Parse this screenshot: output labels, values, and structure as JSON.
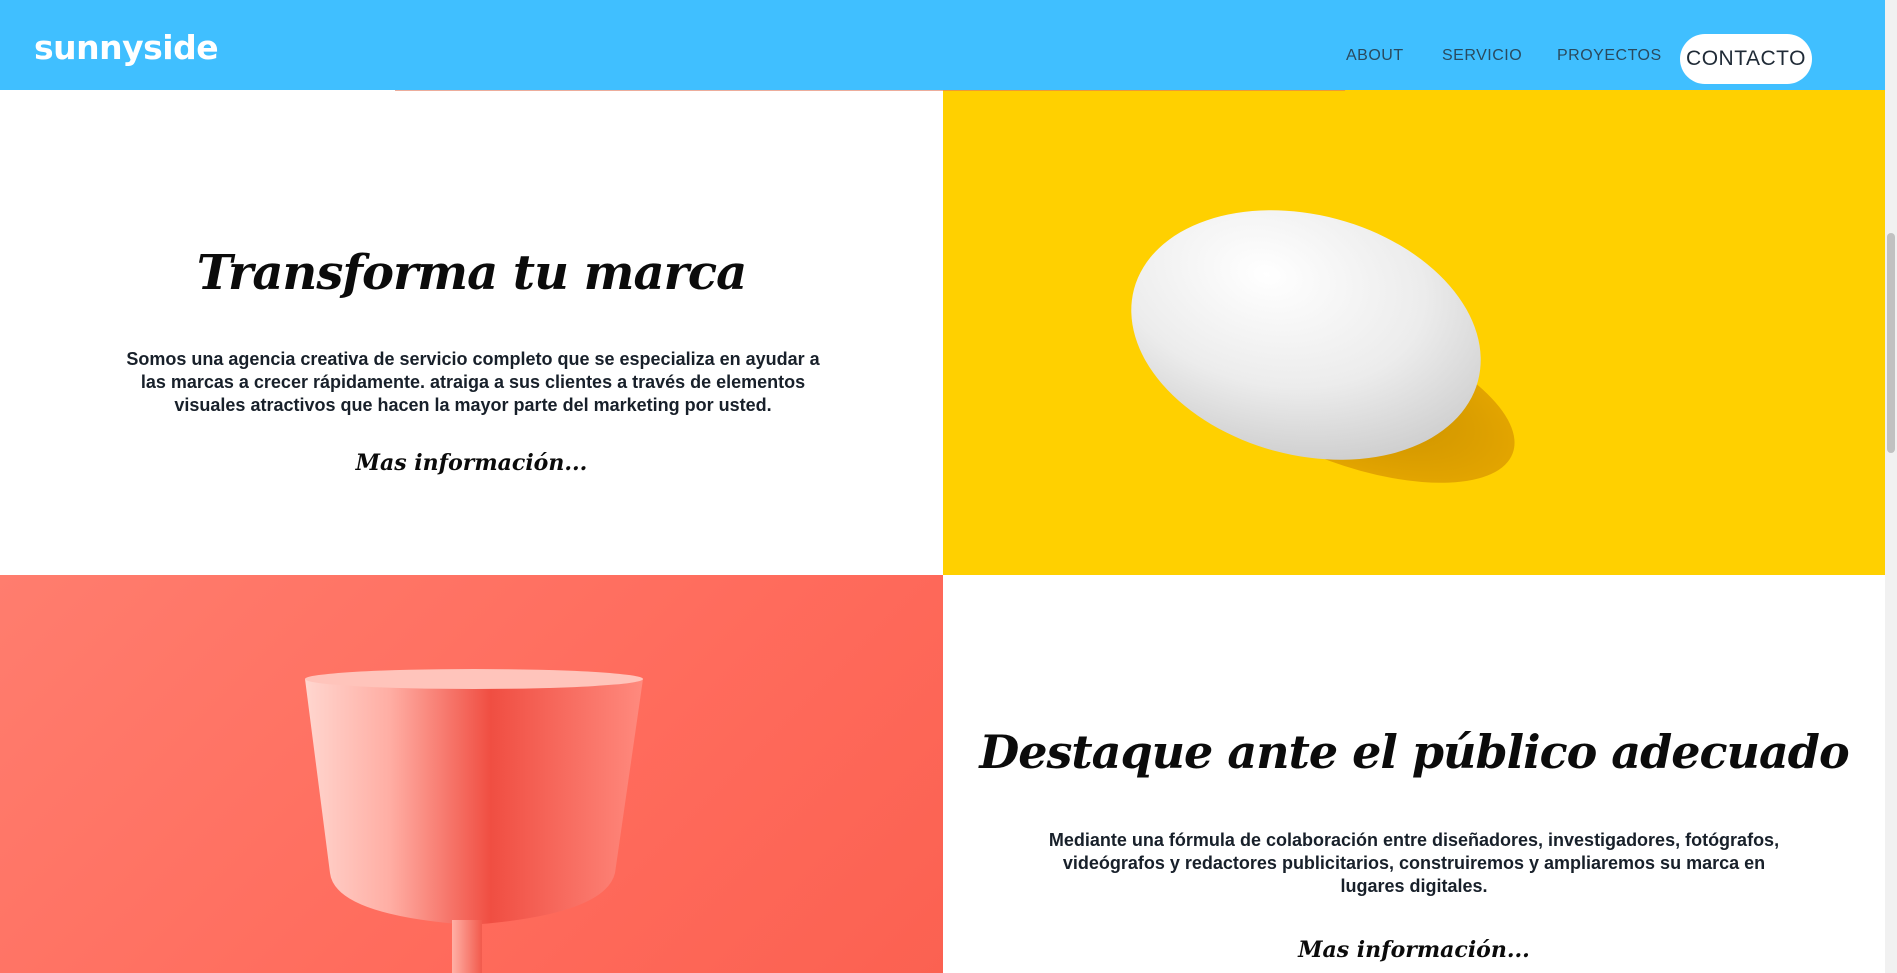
{
  "header": {
    "logo": "sunnyside",
    "nav": [
      {
        "label": "ABOUT"
      },
      {
        "label": "SERVICIO"
      },
      {
        "label": "PROYECTOS"
      }
    ],
    "contact_label": "CONTACTO"
  },
  "section1": {
    "title": "Transforma tu marca",
    "body": "Somos una agencia creativa de servicio completo que se especializa en ayudar a las marcas a crecer rápidamente. atraiga a sus clientes a través de elementos visuales atractivos que hacen la mayor parte del marketing por usted.",
    "link": "Mas información..."
  },
  "section2": {
    "title": "Destaque ante el público adecuado",
    "body": "Mediante una fórmula de colaboración entre diseñadores, investigadores, fotógrafos, videógrafos y redactores publicitarios, construiremos y ampliaremos su marca en lugares digitales.",
    "link": "Mas información..."
  },
  "colors": {
    "header_bg": "#40bfff",
    "egg_bg": "#ffd000",
    "cup_bg": "#ff6b5c"
  }
}
